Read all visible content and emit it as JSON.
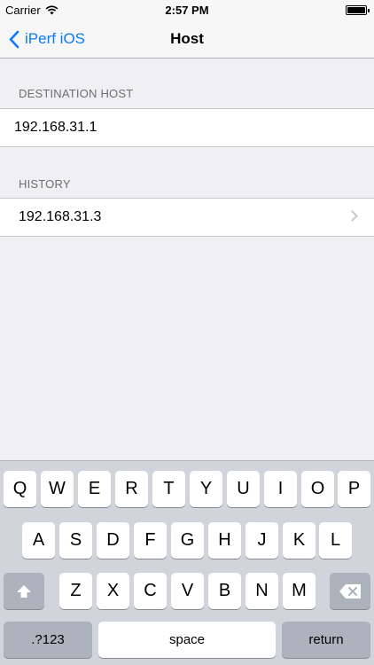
{
  "status_bar": {
    "carrier": "Carrier",
    "time": "2:57 PM"
  },
  "nav": {
    "back_label": "iPerf iOS",
    "title": "Host"
  },
  "destination": {
    "header": "DESTINATION HOST",
    "value": "192.168.31.1"
  },
  "history": {
    "header": "HISTORY",
    "items": [
      "192.168.31.3"
    ]
  },
  "keyboard": {
    "row1": [
      "Q",
      "W",
      "E",
      "R",
      "T",
      "Y",
      "U",
      "I",
      "O",
      "P"
    ],
    "row2": [
      "A",
      "S",
      "D",
      "F",
      "G",
      "H",
      "J",
      "K",
      "L"
    ],
    "row3": [
      "Z",
      "X",
      "C",
      "V",
      "B",
      "N",
      "M"
    ],
    "numbers_label": ".?123",
    "space_label": "space",
    "return_label": "return"
  },
  "colors": {
    "accent": "#0a7aff",
    "background": "#efeff4",
    "keyboard": "#d1d5db"
  }
}
